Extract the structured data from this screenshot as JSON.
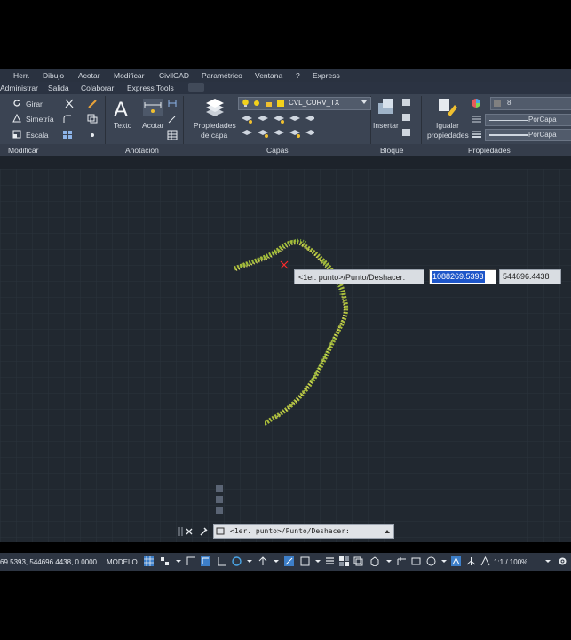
{
  "menu": {
    "items": [
      "Herr.",
      "Dibujo",
      "Acotar",
      "Modificar",
      "CivilCAD",
      "Paramétrico",
      "Ventana",
      "?",
      "Express"
    ]
  },
  "tabs": {
    "items": [
      "Administrar",
      "Salida",
      "Colaborar",
      "Express Tools"
    ]
  },
  "ribbon": {
    "modify": {
      "girar": "Girar",
      "simetria": "Simetría",
      "escala": "Escala",
      "panel_label": "Modificar"
    },
    "annotation": {
      "texto": "Texto",
      "acotar": "Acotar",
      "panel_label": "Anotación"
    },
    "layers": {
      "props_line1": "Propiedades",
      "props_line2": "de capa",
      "current_layer": "CVL_CURV_TX",
      "panel_label": "Capas"
    },
    "block": {
      "insertar": "Insertar",
      "panel_label": "Bloque"
    },
    "properties": {
      "igualar_line1": "Igualar",
      "igualar_line2": "propiedades",
      "color_value": "8",
      "linetype": "PorCapa",
      "lineweight": "PorCapa",
      "panel_label": "Propiedades"
    },
    "accent_layer_color": "#f3d21b"
  },
  "dynamic_input": {
    "prompt": "<1er. punto>/Punto/Deshacer:",
    "x_value": "1088269.5393",
    "y_value": "544696.4438"
  },
  "command_line": {
    "text": "<1er. punto>/Punto/Deshacer:"
  },
  "statusbar": {
    "coords": "69.5393, 544696.4438, 0.0000",
    "model_label": "MODELO",
    "scale": "1:1 / 100%"
  },
  "colors": {
    "canvas_bg": "#212830",
    "ribbon_bg": "#3b4453",
    "survey_points": "#c7d94a",
    "crosshair": "#ff2b2b",
    "active_toggle": "#3d7fc9"
  }
}
